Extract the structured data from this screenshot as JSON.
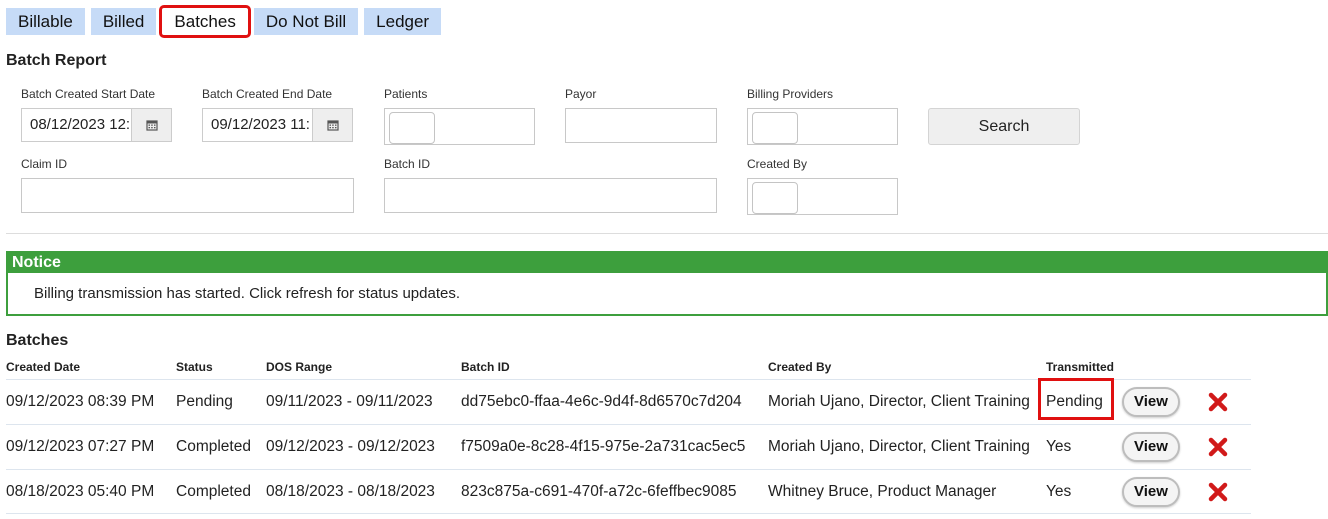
{
  "tabs": [
    {
      "label": "Billable"
    },
    {
      "label": "Billed"
    },
    {
      "label": "Batches"
    },
    {
      "label": "Do Not Bill"
    },
    {
      "label": "Ledger"
    }
  ],
  "active_tab": "Batches",
  "batch_report": {
    "title": "Batch Report",
    "start_date": {
      "label": "Batch Created Start Date",
      "value": "08/12/2023 12:"
    },
    "end_date": {
      "label": "Batch Created End Date",
      "value": "09/12/2023 11:"
    },
    "patients": {
      "label": "Patients"
    },
    "payor": {
      "label": "Payor"
    },
    "billing_providers": {
      "label": "Billing Providers"
    },
    "search_label": "Search",
    "claim_id": {
      "label": "Claim ID"
    },
    "batch_id": {
      "label": "Batch ID"
    },
    "created_by": {
      "label": "Created By"
    }
  },
  "notice": {
    "title": "Notice",
    "message": "Billing transmission has started. Click refresh for status updates."
  },
  "batches": {
    "title": "Batches",
    "headers": {
      "created_date": "Created Date",
      "status": "Status",
      "dos_range": "DOS Range",
      "batch_id": "Batch ID",
      "created_by": "Created By",
      "transmitted": "Transmitted"
    },
    "view_label": "View",
    "rows": [
      {
        "created_date": "09/12/2023 08:39 PM",
        "status": "Pending",
        "dos_range": "09/11/2023 - 09/11/2023",
        "batch_id": "dd75ebc0-ffaa-4e6c-9d4f-8d6570c7d204",
        "created_by": "Moriah Ujano, Director, Client Training",
        "transmitted": "Pending"
      },
      {
        "created_date": "09/12/2023 07:27 PM",
        "status": "Completed",
        "dos_range": "09/12/2023 - 09/12/2023",
        "batch_id": "f7509a0e-8c28-4f15-975e-2a731cac5ec5",
        "created_by": "Moriah Ujano, Director, Client Training",
        "transmitted": "Yes"
      },
      {
        "created_date": "08/18/2023 05:40 PM",
        "status": "Completed",
        "dos_range": "08/18/2023 - 08/18/2023",
        "batch_id": "823c875a-c691-470f-a72c-6feffbec9085",
        "created_by": "Whitney Bruce, Product Manager",
        "transmitted": "Yes"
      }
    ]
  },
  "colors": {
    "tab_bg": "#c6dbf7",
    "highlight": "#e01010",
    "notice_green": "#3d9f3d",
    "delete_red": "#d11a1a"
  },
  "icons": {
    "calendar": "calendar-icon",
    "delete": "delete-x-icon"
  }
}
